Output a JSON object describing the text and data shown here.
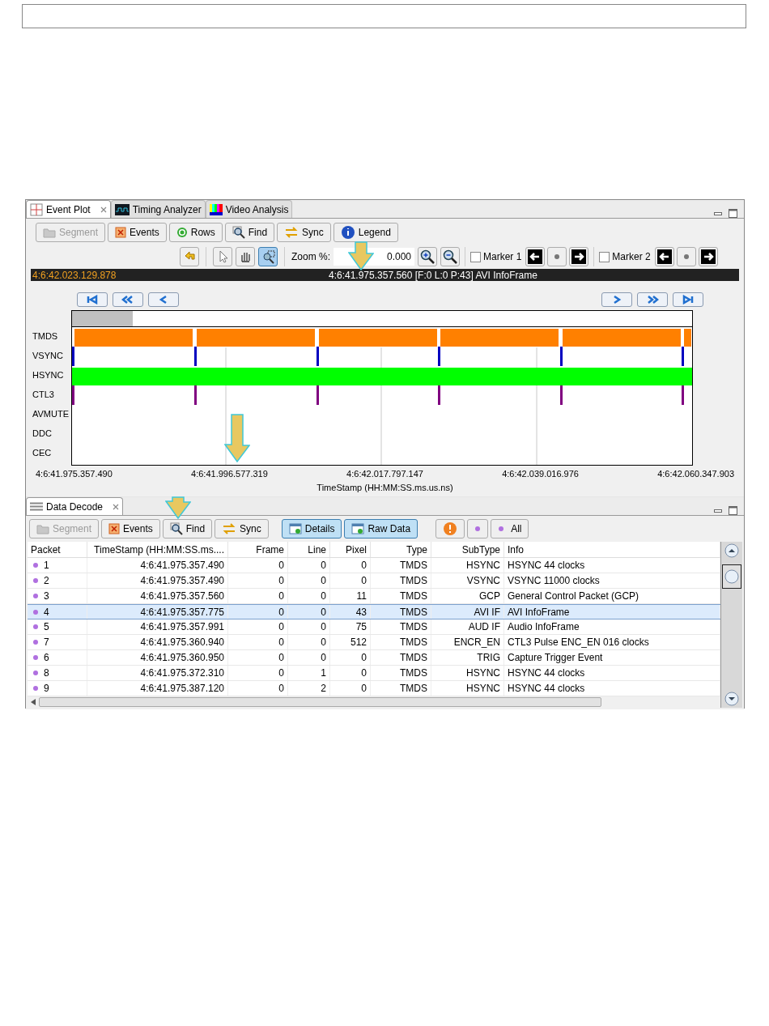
{
  "event_plot": {
    "tabs": [
      {
        "label": "Event Plot",
        "selected": true
      },
      {
        "label": "Timing Analyzer",
        "selected": false
      },
      {
        "label": "Video Analysis",
        "selected": false
      }
    ],
    "toolbar": [
      {
        "label": "Segment",
        "disabled": true
      },
      {
        "label": "Events",
        "disabled": false
      },
      {
        "label": "Rows",
        "disabled": false
      },
      {
        "label": "Find",
        "disabled": false
      },
      {
        "label": "Sync",
        "disabled": false
      },
      {
        "label": "Legend",
        "disabled": false
      }
    ],
    "tools": [
      {
        "kind": "undo",
        "selected": false
      },
      {
        "kind": "pointer",
        "selected": false
      },
      {
        "kind": "hand",
        "selected": false
      },
      {
        "kind": "zoom-select",
        "selected": true
      }
    ],
    "zoom": {
      "label": "Zoom %:",
      "value": "0.000"
    },
    "markers": [
      {
        "label": "Marker 1",
        "checked": false
      },
      {
        "label": "Marker 2",
        "checked": false
      }
    ],
    "status": {
      "cursor": "4:6:42.023.129.878",
      "selection": "4:6:41.975.357.560 [F:0 L:0 P:43] AVI InfoFrame"
    },
    "signals": [
      {
        "name": "TMDS",
        "kind": "bursts",
        "color": "#ff8000"
      },
      {
        "name": "VSYNC",
        "kind": "ticks",
        "color": "#0000c0"
      },
      {
        "name": "HSYNC",
        "kind": "solid",
        "color": "#00ff00"
      },
      {
        "name": "CTL3",
        "kind": "ticks",
        "color": "#800080"
      },
      {
        "name": "AVMUTE",
        "kind": "empty"
      },
      {
        "name": "DDC",
        "kind": "empty"
      },
      {
        "name": "CEC",
        "kind": "empty"
      }
    ],
    "time_ticks": [
      "4:6:41.975.357.490",
      "4:6:41.996.577.319",
      "4:6:42.017.797.147",
      "4:6:42.039.016.976",
      "4:6:42.060.347.903"
    ],
    "axis_title": "TimeStamp (HH:MM:SS.ms.us.ns)"
  },
  "data_decode": {
    "tab": {
      "label": "Data Decode",
      "selected": true
    },
    "toolbar": [
      {
        "label": "Segment",
        "disabled": true,
        "pressed": false
      },
      {
        "label": "Events",
        "disabled": false,
        "pressed": false
      },
      {
        "label": "Find",
        "disabled": false,
        "pressed": false
      },
      {
        "label": "Sync",
        "disabled": false,
        "pressed": false
      },
      {
        "label": "Details",
        "disabled": false,
        "pressed": true
      },
      {
        "label": "Raw Data",
        "disabled": false,
        "pressed": true
      }
    ],
    "filters": [
      {
        "kind": "warning"
      },
      {
        "kind": "dot"
      },
      {
        "kind": "dot",
        "label": "All"
      }
    ],
    "columns": [
      "Packet",
      "TimeStamp (HH:MM:SS.ms....",
      "Frame",
      "Line",
      "Pixel",
      "Type",
      "SubType",
      "Info"
    ],
    "rows": [
      {
        "selected": false,
        "cells": [
          "1",
          "4:6:41.975.357.490",
          "0",
          "0",
          "0",
          "TMDS",
          "HSYNC",
          "HSYNC 44 clocks"
        ]
      },
      {
        "selected": false,
        "cells": [
          "2",
          "4:6:41.975.357.490",
          "0",
          "0",
          "0",
          "TMDS",
          "VSYNC",
          "VSYNC 11000 clocks"
        ]
      },
      {
        "selected": false,
        "cells": [
          "3",
          "4:6:41.975.357.560",
          "0",
          "0",
          "11",
          "TMDS",
          "GCP",
          "General Control Packet (GCP)"
        ]
      },
      {
        "selected": true,
        "cells": [
          "4",
          "4:6:41.975.357.775",
          "0",
          "0",
          "43",
          "TMDS",
          "AVI IF",
          "AVI InfoFrame"
        ]
      },
      {
        "selected": false,
        "cells": [
          "5",
          "4:6:41.975.357.991",
          "0",
          "0",
          "75",
          "TMDS",
          "AUD IF",
          "Audio InfoFrame"
        ]
      },
      {
        "selected": false,
        "cells": [
          "7",
          "4:6:41.975.360.940",
          "0",
          "0",
          "512",
          "TMDS",
          "ENCR_EN",
          "CTL3 Pulse ENC_EN 016 clocks"
        ]
      },
      {
        "selected": false,
        "cells": [
          "6",
          "4:6:41.975.360.950",
          "0",
          "0",
          "0",
          "TMDS",
          "TRIG",
          "Capture Trigger Event"
        ]
      },
      {
        "selected": false,
        "cells": [
          "8",
          "4:6:41.975.372.310",
          "0",
          "1",
          "0",
          "TMDS",
          "HSYNC",
          "HSYNC 44 clocks"
        ]
      },
      {
        "selected": false,
        "cells": [
          "9",
          "4:6:41.975.387.120",
          "0",
          "2",
          "0",
          "TMDS",
          "HSYNC",
          "HSYNC 44 clocks"
        ]
      }
    ]
  }
}
